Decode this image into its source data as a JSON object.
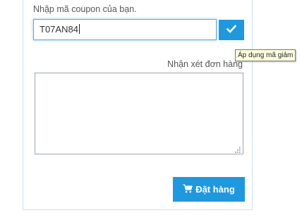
{
  "coupon": {
    "label": "Nhập mã coupon của bạn.",
    "value": "T07AN84",
    "apply_icon": "check-icon",
    "apply_tooltip": "Áp dụng mã giảm"
  },
  "note": {
    "label": "Nhận xét đơn hàng",
    "value": ""
  },
  "order_button": {
    "icon": "shopping-cart-icon",
    "label": "Đặt hàng"
  },
  "colors": {
    "accent": "#1f98de",
    "input_focus_border": "#5aa6d6",
    "panel_border": "#cfe3f0",
    "tooltip_bg": "#ffffe1",
    "text": "#555555"
  }
}
